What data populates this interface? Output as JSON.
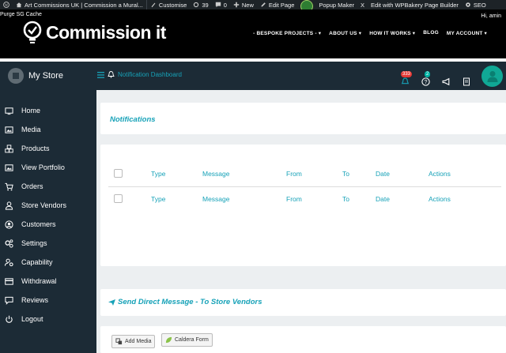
{
  "admin_bar": {
    "site_name": "Art Commissions UK | Commission a Mural...",
    "customise": "Customise",
    "updates_count": "39",
    "comments_count": "0",
    "new": "New",
    "edit_page": "Edit Page",
    "popup_maker": "Popup Maker",
    "wpbakery": "Edit with WPBakery Page Builder",
    "seo": "SEO",
    "close_x": "X"
  },
  "site_header": {
    "purge": "Purge SG Cache",
    "greeting": "Hi, amin",
    "logo_text": "Commission it",
    "nav": [
      "- BESPOKE PROJECTS - ▾",
      "ABOUT US ▾",
      "HOW IT WORKS ▾",
      "BLOG",
      "MY ACCOUNT ▾"
    ]
  },
  "store_bar": {
    "store_name": "My Store",
    "notification_link": "Notification Dashboard",
    "notif_badge": "333",
    "help_badge": "2"
  },
  "sidebar": {
    "items": [
      {
        "label": "Home",
        "icon": "monitor-icon"
      },
      {
        "label": "Media",
        "icon": "image-icon"
      },
      {
        "label": "Products",
        "icon": "cubes-icon"
      },
      {
        "label": "View Portfolio",
        "icon": "image-icon"
      },
      {
        "label": "Orders",
        "icon": "cart-icon"
      },
      {
        "label": "Store Vendors",
        "icon": "user-icon"
      },
      {
        "label": "Customers",
        "icon": "user-circle-icon"
      },
      {
        "label": "Settings",
        "icon": "gears-icon"
      },
      {
        "label": "Capability",
        "icon": "user-cog-icon"
      },
      {
        "label": "Withdrawal",
        "icon": "credit-card-icon"
      },
      {
        "label": "Reviews",
        "icon": "comment-icon"
      },
      {
        "label": "Logout",
        "icon": "power-icon"
      }
    ]
  },
  "notifications": {
    "title": "Notifications",
    "columns": [
      "Type",
      "Message",
      "From",
      "To",
      "Date",
      "Actions"
    ]
  },
  "direct_message": {
    "title": "Send Direct Message - To Store Vendors",
    "add_media": "Add Media",
    "caldera_form": "Caldera Form"
  },
  "colors": {
    "accent": "#17a2b8",
    "sidebar_bg": "#1c2b36",
    "badge_red": "#e53935"
  }
}
